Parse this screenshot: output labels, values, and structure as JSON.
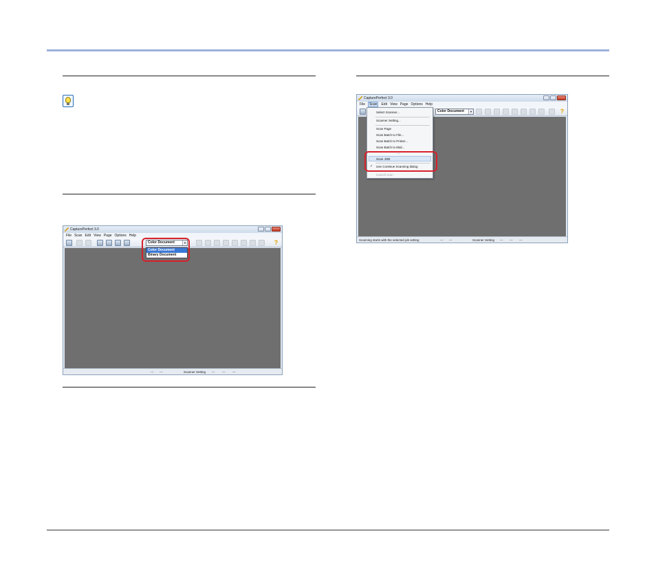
{
  "windows": {
    "left": {
      "title": "CapturePerfect 3.0",
      "menu": [
        "File",
        "Scan",
        "Edit",
        "View",
        "Page",
        "Options",
        "Help"
      ],
      "document_mode": "Color Document",
      "dropdown_options": [
        "Color Document",
        "Binary Document"
      ],
      "status": [
        "---",
        "---",
        "Scanner Setting",
        "---",
        "---",
        "---"
      ]
    },
    "right": {
      "title": "CapturePerfect 3.0",
      "menu": [
        "File",
        "Scan",
        "Edit",
        "View",
        "Page",
        "Options",
        "Help"
      ],
      "document_mode": "Color Document",
      "scan_menu": {
        "items": [
          "Select Scanner...",
          "Scanner Setting...",
          "Scan Page",
          "Scan Batch to File...",
          "Scan Batch to Printer...",
          "Scan Batch to Mail...",
          "...",
          "Scan JOB",
          "Use Continue Scanning dialog",
          "Cancel scan"
        ],
        "checked_item": "Use Continue Scanning dialog",
        "disabled_item": "Cancel scan"
      },
      "status": [
        "Scanning starts with the selected job setting",
        "---",
        "---",
        "Scanner Setting",
        "---",
        "---",
        "---"
      ]
    }
  },
  "colors": {
    "accent_rule": "#7f9ccf",
    "callout": "#d8202a",
    "canvas": "#6f6f6f"
  },
  "icons": [
    "hint-icon",
    "app-icon"
  ]
}
